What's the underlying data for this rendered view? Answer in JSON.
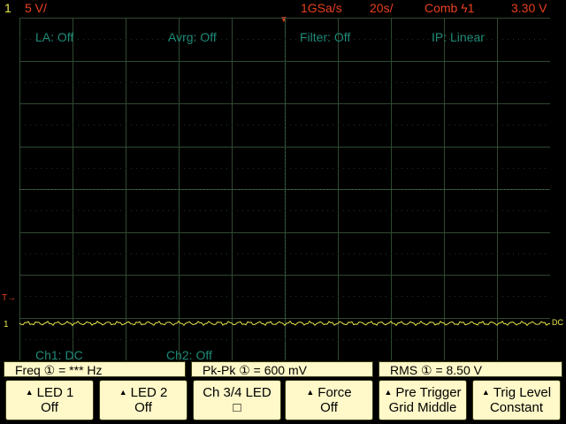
{
  "top": {
    "channel_num": "1",
    "vertical_scale": "5 V/",
    "sample_rate": "1GSa/s",
    "timebase": "20s/",
    "trigger_mode": "Comb",
    "trigger_source": "ϟ1",
    "trigger_level": "3.30 V"
  },
  "status": {
    "la": "LA: Off",
    "avrg": "Avrg: Off",
    "filter": "Filter: Off",
    "ip": "IP: Linear",
    "ch1": "Ch1: DC",
    "ch2": "Ch2: Off"
  },
  "markers": {
    "ch1": "1",
    "dc": "DC",
    "trigger_arrow": "T→",
    "trigger_pos": "T"
  },
  "measurements": {
    "freq": "Freq ① = *** Hz",
    "pkpk": "Pk-Pk ① = 600 mV",
    "rms": "RMS ① =  8.50  V"
  },
  "softkeys": [
    {
      "line1": "LED 1",
      "line2": "Off",
      "arrow": true
    },
    {
      "line1": "LED 2",
      "line2": "Off",
      "arrow": true
    },
    {
      "line1": "Ch 3/4 LED",
      "line2": "□",
      "arrow": false
    },
    {
      "line1": "Force",
      "line2": "Off",
      "arrow": true
    },
    {
      "line1": "Pre Trigger",
      "line2": "Grid Middle",
      "arrow": true
    },
    {
      "line1": "Trig Level",
      "line2": "Constant",
      "arrow": true
    }
  ],
  "colors": {
    "grid": "#2e4a32",
    "trace": "#e8e84a",
    "accent": "#e8401e",
    "status_text": "#1f8a78"
  }
}
